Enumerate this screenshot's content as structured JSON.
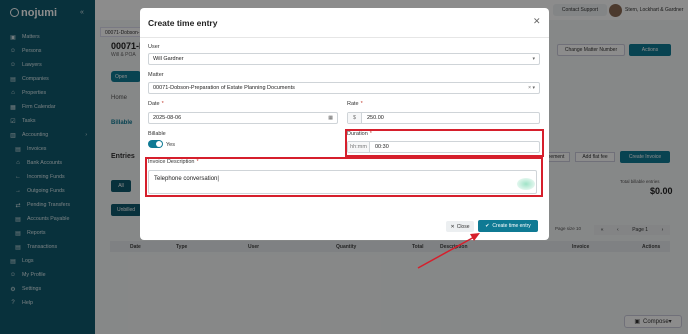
{
  "app": {
    "logo": "nojumi"
  },
  "sidebar": {
    "items": [
      {
        "icon": "briefcase-icon",
        "glyph": "▣",
        "label": "Matters"
      },
      {
        "icon": "persons-icon",
        "glyph": "☺",
        "label": "Persons"
      },
      {
        "icon": "lawyers-icon",
        "glyph": "☺",
        "label": "Lawyers"
      },
      {
        "icon": "companies-icon",
        "glyph": "▤",
        "label": "Companies"
      },
      {
        "icon": "properties-icon",
        "glyph": "⌂",
        "label": "Properties"
      },
      {
        "icon": "calendar-icon",
        "glyph": "▦",
        "label": "Firm Calendar"
      },
      {
        "icon": "tasks-icon",
        "glyph": "☑",
        "label": "Tasks"
      },
      {
        "icon": "accounting-icon",
        "glyph": "▥",
        "label": "Accounting"
      },
      {
        "icon": "invoice-icon",
        "glyph": "▤",
        "label": "Invoices"
      },
      {
        "icon": "bank-icon",
        "glyph": "⌂",
        "label": "Bank Accounts"
      },
      {
        "icon": "incoming-icon",
        "glyph": "←",
        "label": "Incoming Funds"
      },
      {
        "icon": "outgoing-icon",
        "glyph": "→",
        "label": "Outgoing Funds"
      },
      {
        "icon": "transfer-icon",
        "glyph": "⇄",
        "label": "Pending Transfers"
      },
      {
        "icon": "payable-icon",
        "glyph": "▤",
        "label": "Accounts Payable"
      },
      {
        "icon": "reports-icon",
        "glyph": "▤",
        "label": "Reports"
      },
      {
        "icon": "transactions-icon",
        "glyph": "▤",
        "label": "Transactions"
      },
      {
        "icon": "logs-icon",
        "glyph": "▤",
        "label": "Logs"
      },
      {
        "icon": "profile-icon",
        "glyph": "☺",
        "label": "My Profile"
      },
      {
        "icon": "settings-icon",
        "glyph": "⚙",
        "label": "Settings"
      },
      {
        "icon": "help-icon",
        "glyph": "?",
        "label": "Help"
      }
    ]
  },
  "topbar": {
    "support": "Contact Support",
    "user": "Stern, Lockhart & Gardner"
  },
  "background": {
    "tab": "00071-Dobson-",
    "title": "00071-D",
    "subtitle": "Will & POA",
    "open_btn": "Open",
    "home": "Home",
    "billable_tab": "Billable",
    "entries": "Entries",
    "all_btn": "All",
    "unbilled_btn": "Unbilled",
    "change_matter": "Change Matter Number",
    "actions": "Actions",
    "agreement": "eement",
    "add_flat_fee": "Add flat fee",
    "create_invoice": "Create Invoice",
    "total_label": "Total billable entries",
    "total_value": "$0.00",
    "page_size_label": "Page size",
    "page_size_value": "10",
    "page_label": "Page 1",
    "table_headers": [
      "Date",
      "Type",
      "User",
      "Quantity",
      "Total",
      "Description",
      "Invoice",
      "Actions"
    ],
    "compose": "Compose"
  },
  "modal": {
    "title": "Create time entry",
    "user_label": "User",
    "user_value": "Will Gardner",
    "matter_label": "Matter",
    "matter_value": "00071-Dobson-Preparation of Estate Planning Documents",
    "date_label": "Date",
    "date_value": "2025-08-06",
    "rate_label": "Rate",
    "rate_prefix": "$",
    "rate_value": "250.00",
    "billable_label": "Billable",
    "billable_value": "Yes",
    "billable_on": true,
    "duration_label": "Duration",
    "duration_prefix": "hh:mm",
    "duration_value": "00:30",
    "description_label": "Invoice Description",
    "description_value": "Telephone conversation",
    "close_btn": "Close",
    "create_btn": "Create time entry"
  },
  "colors": {
    "sidebar": "#0f5a6e",
    "primary": "#0f7a94",
    "highlight": "#d61f2c"
  }
}
